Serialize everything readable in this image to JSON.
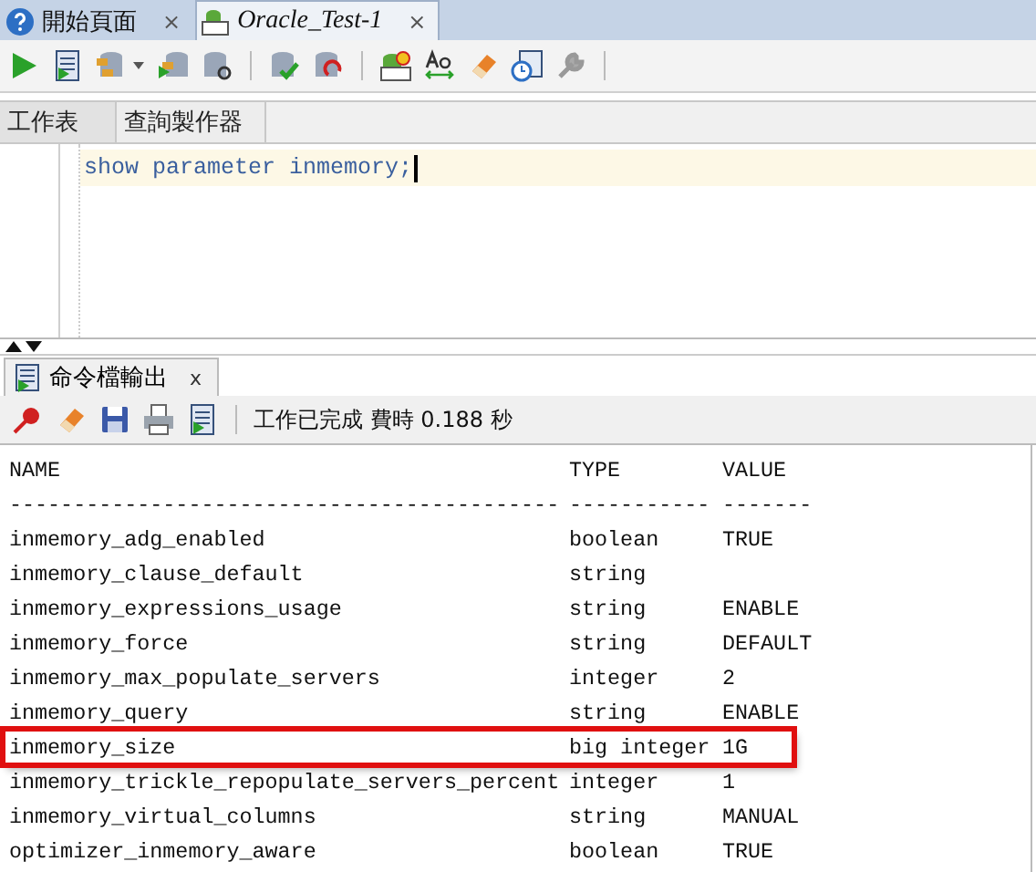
{
  "document_tabs": [
    {
      "label": "開始頁面",
      "selected": false,
      "close": "×"
    },
    {
      "label": "Oracle_Test-1",
      "selected": true,
      "close": "×"
    }
  ],
  "editor_tabs": [
    {
      "label": "工作表",
      "selected": true
    },
    {
      "label": "查詢製作器",
      "selected": false
    }
  ],
  "editor": {
    "text": "show parameter inmemory;"
  },
  "output_panel": {
    "tab": {
      "label": "命令檔輸出",
      "close": "x"
    },
    "status": "工作已完成 費時 0.188 秒",
    "columns": [
      "NAME",
      "TYPE",
      "VALUE"
    ],
    "separator": [
      "-------------------------------------------",
      "-----------",
      "-------"
    ],
    "rows": [
      {
        "name": "inmemory_adg_enabled",
        "type": "boolean",
        "value": "TRUE",
        "highlighted": false
      },
      {
        "name": "inmemory_clause_default",
        "type": "string",
        "value": "",
        "highlighted": false
      },
      {
        "name": "inmemory_expressions_usage",
        "type": "string",
        "value": "ENABLE",
        "highlighted": false
      },
      {
        "name": "inmemory_force",
        "type": "string",
        "value": "DEFAULT",
        "highlighted": false
      },
      {
        "name": "inmemory_max_populate_servers",
        "type": "integer",
        "value": "2",
        "highlighted": false
      },
      {
        "name": "inmemory_query",
        "type": "string",
        "value": "ENABLE",
        "highlighted": false
      },
      {
        "name": "inmemory_size",
        "type": "big integer",
        "value": "1G",
        "highlighted": true
      },
      {
        "name": "inmemory_trickle_repopulate_servers_percent",
        "type": "integer",
        "value": "1",
        "highlighted": false
      },
      {
        "name": "inmemory_virtual_columns",
        "type": "string",
        "value": "MANUAL",
        "highlighted": false
      },
      {
        "name": "optimizer_inmemory_aware",
        "type": "boolean",
        "value": "TRUE",
        "highlighted": false
      }
    ]
  }
}
